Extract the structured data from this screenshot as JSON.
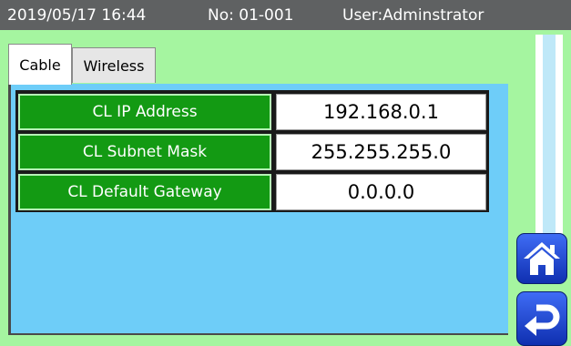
{
  "status": {
    "datetime": "2019/05/17 16:44",
    "number": "No: 01-001",
    "user": "User:Adminstrator"
  },
  "tabs": [
    {
      "label": "Cable",
      "active": true
    },
    {
      "label": "Wireless",
      "active": false
    }
  ],
  "network": {
    "rows": [
      {
        "label": "CL IP Address",
        "value": "192.168.0.1"
      },
      {
        "label": "CL Subnet Mask",
        "value": "255.255.255.0"
      },
      {
        "label": "CL Default Gateway",
        "value": "0.0.0.0"
      }
    ]
  },
  "nav": {
    "home_icon": "home-icon",
    "return_icon": "return-arrow-icon"
  },
  "colors": {
    "background": "#a5f5a0",
    "status_bar": "#5f6162",
    "panel": "#6ecdf8",
    "label_cell": "#139a13",
    "nav_button": "#2a4fe0"
  }
}
